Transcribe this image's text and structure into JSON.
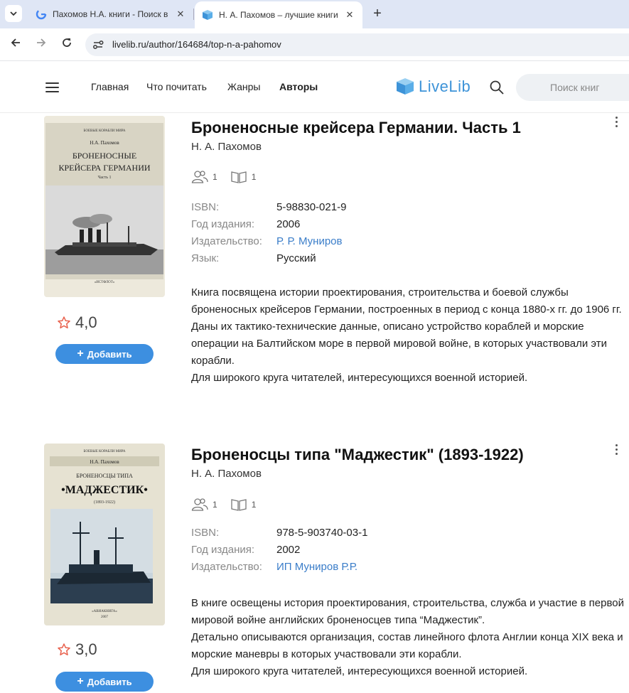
{
  "browser": {
    "tabs": [
      {
        "title": "Пахомов Н.А. книги - Поиск в",
        "close": "✕"
      },
      {
        "title": "Н. А. Пахомов – лучшие книги",
        "close": "✕"
      }
    ],
    "new_tab": "+",
    "url": "livelib.ru/author/164684/top-n-a-pahomov"
  },
  "site": {
    "nav": [
      "Главная",
      "Что почитать",
      "Жанры",
      "Авторы"
    ],
    "active_nav": "Авторы",
    "logo_text": "LiveLib",
    "search_placeholder": "Поиск книг",
    "colors": {
      "accent": "#3d8fe0",
      "logo": "#3d93d8",
      "link": "#3a7dc9",
      "star": "#e8604c"
    }
  },
  "books": [
    {
      "title": "Броненосные крейсера Германии. Часть 1",
      "author": "Н. А. Пахомов",
      "readers": "1",
      "reviews": "1",
      "meta": [
        {
          "k": "ISBN:",
          "v": "5-98830-021-9"
        },
        {
          "k": "Год издания:",
          "v": "2006"
        },
        {
          "k": "Издательство:",
          "v": "Р. Р. Муниров"
        },
        {
          "k": "Язык:",
          "v": "Русский"
        }
      ],
      "description": [
        "Книга посвящена истории проектирования, строительства и боевой службы броненосных крейсеров Германии, построенных в период с конца 1880-х гг. до 1906 гг.",
        "Даны их тактико-технические данные, описано устройство кораблей и морские операции на Балтийском море в первой мировой войне, в которых участвовали эти корабли.",
        "Для широкого круга читателей, интересующихся военной историей."
      ],
      "rating": "4,0",
      "add_label": "Добавить",
      "cover": {
        "series": "БОЕВЫЕ КОРАБЛИ МИРА",
        "author": "Н.А. Пахомов",
        "title_l1": "БРОНЕНОСНЫЕ",
        "title_l2": "КРЕЙСЕРА ГЕРМАНИИ",
        "part": "Часть 1",
        "publisher": "«ИСТФЛОТ»"
      }
    },
    {
      "title": "Броненосцы типа \"Маджестик\" (1893-1922)",
      "author": "Н. А. Пахомов",
      "readers": "1",
      "reviews": "1",
      "meta": [
        {
          "k": "ISBN:",
          "v": "978-5-903740-03-1"
        },
        {
          "k": "Год издания:",
          "v": "2002"
        },
        {
          "k": "Издательство:",
          "v": "ИП Муниров Р.Р."
        }
      ],
      "description": [
        "В книге освещены история проектирования, строительства, служба и участие в первой мировой войне английских броненосцев типа “Маджестик”.",
        "Детально описываются организация, состав линейного флота Англии конца XIX века и морские маневры в которых участвовали эти корабли.",
        "Для широкого круга читателей, интересующихся военной историей."
      ],
      "rating": "3,0",
      "add_label": "Добавить",
      "cover": {
        "series": "БОЕВЫЕ КОРАБЛИ МИРА",
        "author": "Н.А. Пахомов",
        "title_l1": "БРОНЕНОСЦЫ ТИПА",
        "title_l2": "•МАДЖЕСТИК•",
        "years": "(1893-1922)",
        "publisher": "«АВИАКНИГА»",
        "year": "2007"
      }
    }
  ]
}
